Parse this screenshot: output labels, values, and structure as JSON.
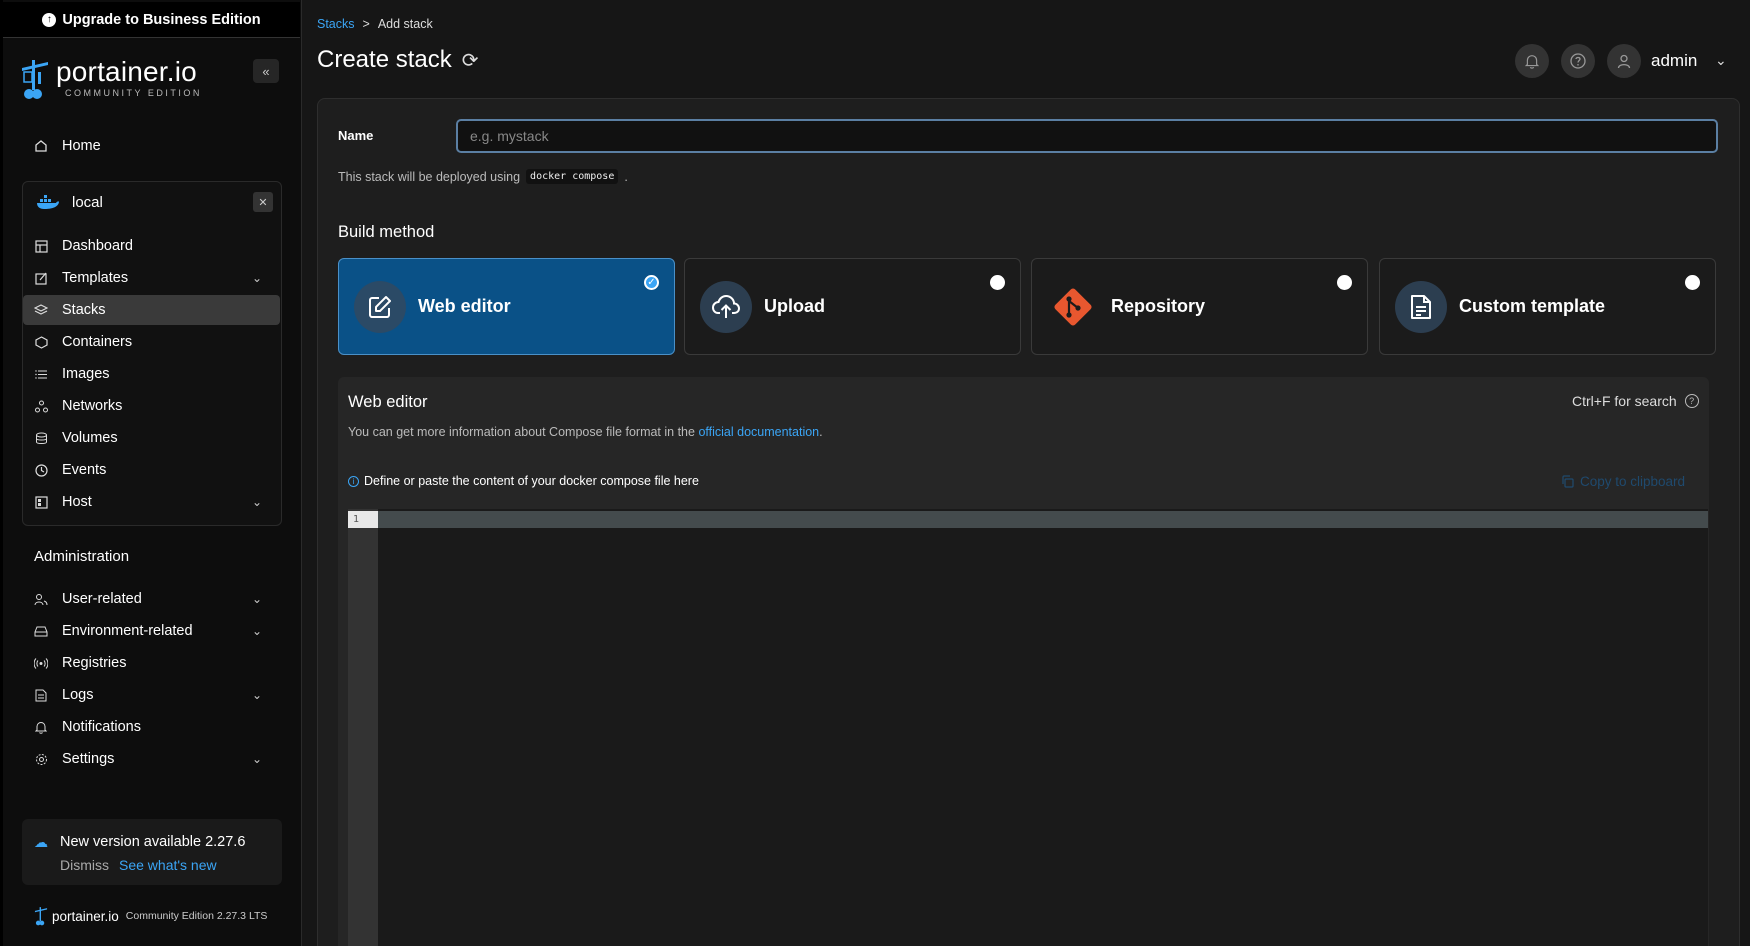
{
  "sidebar": {
    "upgrade_label": "Upgrade to Business Edition",
    "logo_text": "portainer.io",
    "logo_sub": "COMMUNITY EDITION",
    "collapse_icon": "«",
    "home_label": "Home",
    "environment": {
      "name": "local",
      "items": [
        {
          "label": "Dashboard",
          "icon": "dashboard-icon"
        },
        {
          "label": "Templates",
          "icon": "templates-icon",
          "expandable": true
        },
        {
          "label": "Stacks",
          "icon": "stacks-icon",
          "active": true
        },
        {
          "label": "Containers",
          "icon": "containers-icon"
        },
        {
          "label": "Images",
          "icon": "images-icon"
        },
        {
          "label": "Networks",
          "icon": "networks-icon"
        },
        {
          "label": "Volumes",
          "icon": "volumes-icon"
        },
        {
          "label": "Events",
          "icon": "events-icon"
        },
        {
          "label": "Host",
          "icon": "host-icon",
          "expandable": true
        }
      ]
    },
    "administration": {
      "title": "Administration",
      "items": [
        {
          "label": "User-related",
          "icon": "users-icon",
          "expandable": true
        },
        {
          "label": "Environment-related",
          "icon": "environment-icon",
          "expandable": true
        },
        {
          "label": "Registries",
          "icon": "registries-icon"
        },
        {
          "label": "Logs",
          "icon": "logs-icon",
          "expandable": true
        },
        {
          "label": "Notifications",
          "icon": "bell-icon"
        },
        {
          "label": "Settings",
          "icon": "gear-icon",
          "expandable": true
        }
      ]
    },
    "update": {
      "title": "New version available 2.27.6",
      "dismiss": "Dismiss",
      "whats_new": "See what's new"
    },
    "footer": {
      "logo_text": "portainer.io",
      "version": "Community Edition 2.27.3 LTS"
    }
  },
  "header": {
    "breadcrumb_link": "Stacks",
    "breadcrumb_sep": ">",
    "breadcrumb_current": "Add stack",
    "title": "Create stack",
    "user": "admin"
  },
  "form": {
    "name_label": "Name",
    "name_placeholder": "e.g. mystack",
    "name_value": "",
    "hint_text": "This stack will be deployed using",
    "hint_code": "docker compose",
    "hint_end": ".",
    "build_method_title": "Build method",
    "methods": [
      {
        "label": "Web editor",
        "icon": "edit-icon",
        "selected": true
      },
      {
        "label": "Upload",
        "icon": "upload-cloud-icon",
        "selected": false
      },
      {
        "label": "Repository",
        "icon": "git-icon",
        "selected": false
      },
      {
        "label": "Custom template",
        "icon": "document-icon",
        "selected": false
      }
    ]
  },
  "editor": {
    "title": "Web editor",
    "search_hint": "Ctrl+F for search",
    "info_text": "You can get more information about Compose file format in the",
    "info_link": "official documentation",
    "info_end": ".",
    "define_hint": "Define or paste the content of your docker compose file here",
    "copy_label": "Copy to clipboard",
    "line_number": "1"
  },
  "colors": {
    "accent": "#3ba5f5",
    "selected_card": "#0a5187",
    "git_orange": "#e8572f"
  }
}
